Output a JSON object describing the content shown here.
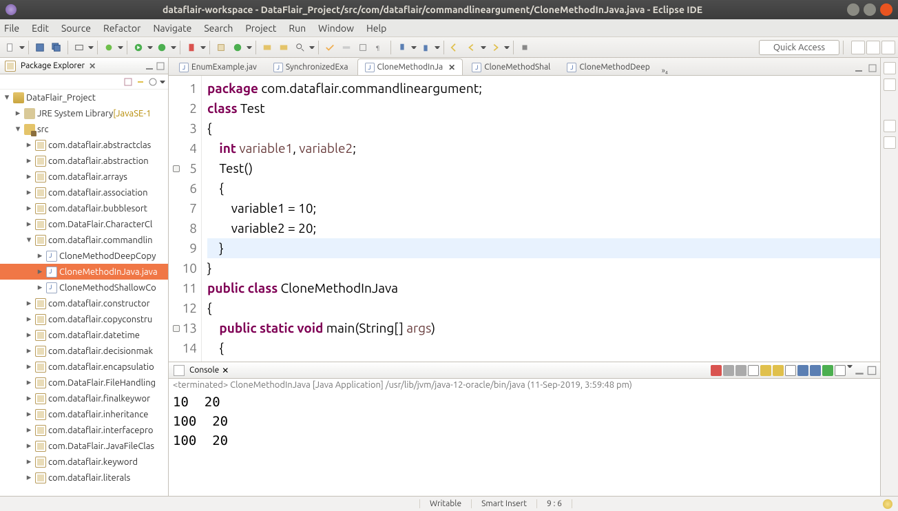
{
  "title": "dataflair-workspace - DataFlair_Project/src/com/dataflair/commandlineargument/CloneMethodInJava.java - Eclipse IDE",
  "menus": [
    "File",
    "Edit",
    "Source",
    "Refactor",
    "Navigate",
    "Search",
    "Project",
    "Run",
    "Window",
    "Help"
  ],
  "quick_access": "Quick Access",
  "package_explorer": {
    "title": "Package Explorer",
    "project": "DataFlair_Project",
    "jre": "JRE System Library",
    "jre_decor": "[JavaSE-1",
    "src": "src",
    "packages": [
      "com.dataflair.abstractclas",
      "com.dataflair.abstraction",
      "com.dataflair.arrays",
      "com.dataflair.association",
      "com.dataflair.bubblesort",
      "com.DataFlair.CharacterCl",
      "com.dataflair.commandlin",
      "com.dataflair.constructor",
      "com.dataflair.copyconstru",
      "com.dataflair.datetime",
      "com.dataflair.decisionmak",
      "com.dataflair.encapsulatio",
      "com.DataFlair.FileHandling",
      "com.dataflair.finalkeywor",
      "com.dataflair.inheritance",
      "com.dataflair.interfacepro",
      "com.DataFlair.JavaFileClas",
      "com.dataflair.keyword",
      "com.dataflair.literals"
    ],
    "commandline_files": [
      "CloneMethodDeepCopy",
      "CloneMethodInJava.java",
      "CloneMethodShallowCo"
    ],
    "selected": "CloneMethodInJava.java"
  },
  "editor_tabs": [
    {
      "label": "EnumExample.jav",
      "active": false
    },
    {
      "label": "SynchronizedExa",
      "active": false
    },
    {
      "label": "CloneMethodInJa",
      "active": true
    },
    {
      "label": "CloneMethodShal",
      "active": false
    },
    {
      "label": "CloneMethodDeep",
      "active": false
    }
  ],
  "editor_more": "»₄",
  "code_lines": [
    {
      "n": 1,
      "html": "<span class='kw'>package</span> com.dataflair.commandlineargument;"
    },
    {
      "n": 2,
      "html": "<span class='kw'>class</span> <span class='cls'>Test</span>"
    },
    {
      "n": 3,
      "html": "{"
    },
    {
      "n": 4,
      "html": "    <span class='typ'>int</span> <span class='param'>variable1</span>, <span class='param'>variable2</span>;"
    },
    {
      "n": 5,
      "html": "    Test()",
      "mark": true
    },
    {
      "n": 6,
      "html": "    {",
      "box": true
    },
    {
      "n": 7,
      "html": "        variable1 = 10;"
    },
    {
      "n": 8,
      "html": "        variable2 = 20;"
    },
    {
      "n": 9,
      "html": "    }",
      "hl": true
    },
    {
      "n": 10,
      "html": "}"
    },
    {
      "n": 11,
      "html": "<span class='kw'>public</span> <span class='kw'>class</span> <span class='cls'>CloneMethodInJava</span>"
    },
    {
      "n": 12,
      "html": "{"
    },
    {
      "n": 13,
      "html": "    <span class='kw'>public</span> <span class='kw'>static</span> <span class='typ'>void</span> main(String[] <span class='param'>args</span>)",
      "mark": true
    },
    {
      "n": 14,
      "html": "    {"
    }
  ],
  "console": {
    "title": "Console",
    "terminated": "<terminated> CloneMethodInJava [Java Application] /usr/lib/jvm/java-12-oracle/bin/java (11-Sep-2019, 3:59:48 pm)",
    "output": "10  20\n100  20\n100  20"
  },
  "status": {
    "writable": "Writable",
    "insert": "Smart Insert",
    "pos": "9 : 6"
  }
}
